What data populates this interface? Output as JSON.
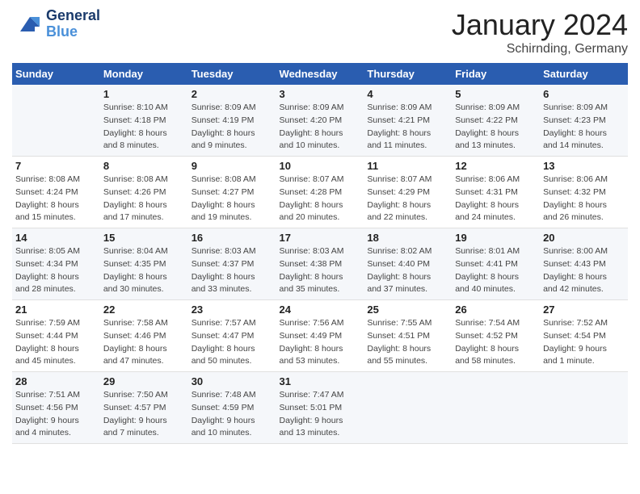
{
  "header": {
    "logo": {
      "general": "General",
      "blue": "Blue"
    },
    "title": "January 2024",
    "location": "Schirnding, Germany"
  },
  "days_of_week": [
    "Sunday",
    "Monday",
    "Tuesday",
    "Wednesday",
    "Thursday",
    "Friday",
    "Saturday"
  ],
  "weeks": [
    [
      {
        "day": "",
        "info": ""
      },
      {
        "day": "1",
        "info": "Sunrise: 8:10 AM\nSunset: 4:18 PM\nDaylight: 8 hours\nand 8 minutes."
      },
      {
        "day": "2",
        "info": "Sunrise: 8:09 AM\nSunset: 4:19 PM\nDaylight: 8 hours\nand 9 minutes."
      },
      {
        "day": "3",
        "info": "Sunrise: 8:09 AM\nSunset: 4:20 PM\nDaylight: 8 hours\nand 10 minutes."
      },
      {
        "day": "4",
        "info": "Sunrise: 8:09 AM\nSunset: 4:21 PM\nDaylight: 8 hours\nand 11 minutes."
      },
      {
        "day": "5",
        "info": "Sunrise: 8:09 AM\nSunset: 4:22 PM\nDaylight: 8 hours\nand 13 minutes."
      },
      {
        "day": "6",
        "info": "Sunrise: 8:09 AM\nSunset: 4:23 PM\nDaylight: 8 hours\nand 14 minutes."
      }
    ],
    [
      {
        "day": "7",
        "info": "Sunrise: 8:08 AM\nSunset: 4:24 PM\nDaylight: 8 hours\nand 15 minutes."
      },
      {
        "day": "8",
        "info": "Sunrise: 8:08 AM\nSunset: 4:26 PM\nDaylight: 8 hours\nand 17 minutes."
      },
      {
        "day": "9",
        "info": "Sunrise: 8:08 AM\nSunset: 4:27 PM\nDaylight: 8 hours\nand 19 minutes."
      },
      {
        "day": "10",
        "info": "Sunrise: 8:07 AM\nSunset: 4:28 PM\nDaylight: 8 hours\nand 20 minutes."
      },
      {
        "day": "11",
        "info": "Sunrise: 8:07 AM\nSunset: 4:29 PM\nDaylight: 8 hours\nand 22 minutes."
      },
      {
        "day": "12",
        "info": "Sunrise: 8:06 AM\nSunset: 4:31 PM\nDaylight: 8 hours\nand 24 minutes."
      },
      {
        "day": "13",
        "info": "Sunrise: 8:06 AM\nSunset: 4:32 PM\nDaylight: 8 hours\nand 26 minutes."
      }
    ],
    [
      {
        "day": "14",
        "info": "Sunrise: 8:05 AM\nSunset: 4:34 PM\nDaylight: 8 hours\nand 28 minutes."
      },
      {
        "day": "15",
        "info": "Sunrise: 8:04 AM\nSunset: 4:35 PM\nDaylight: 8 hours\nand 30 minutes."
      },
      {
        "day": "16",
        "info": "Sunrise: 8:03 AM\nSunset: 4:37 PM\nDaylight: 8 hours\nand 33 minutes."
      },
      {
        "day": "17",
        "info": "Sunrise: 8:03 AM\nSunset: 4:38 PM\nDaylight: 8 hours\nand 35 minutes."
      },
      {
        "day": "18",
        "info": "Sunrise: 8:02 AM\nSunset: 4:40 PM\nDaylight: 8 hours\nand 37 minutes."
      },
      {
        "day": "19",
        "info": "Sunrise: 8:01 AM\nSunset: 4:41 PM\nDaylight: 8 hours\nand 40 minutes."
      },
      {
        "day": "20",
        "info": "Sunrise: 8:00 AM\nSunset: 4:43 PM\nDaylight: 8 hours\nand 42 minutes."
      }
    ],
    [
      {
        "day": "21",
        "info": "Sunrise: 7:59 AM\nSunset: 4:44 PM\nDaylight: 8 hours\nand 45 minutes."
      },
      {
        "day": "22",
        "info": "Sunrise: 7:58 AM\nSunset: 4:46 PM\nDaylight: 8 hours\nand 47 minutes."
      },
      {
        "day": "23",
        "info": "Sunrise: 7:57 AM\nSunset: 4:47 PM\nDaylight: 8 hours\nand 50 minutes."
      },
      {
        "day": "24",
        "info": "Sunrise: 7:56 AM\nSunset: 4:49 PM\nDaylight: 8 hours\nand 53 minutes."
      },
      {
        "day": "25",
        "info": "Sunrise: 7:55 AM\nSunset: 4:51 PM\nDaylight: 8 hours\nand 55 minutes."
      },
      {
        "day": "26",
        "info": "Sunrise: 7:54 AM\nSunset: 4:52 PM\nDaylight: 8 hours\nand 58 minutes."
      },
      {
        "day": "27",
        "info": "Sunrise: 7:52 AM\nSunset: 4:54 PM\nDaylight: 9 hours\nand 1 minute."
      }
    ],
    [
      {
        "day": "28",
        "info": "Sunrise: 7:51 AM\nSunset: 4:56 PM\nDaylight: 9 hours\nand 4 minutes."
      },
      {
        "day": "29",
        "info": "Sunrise: 7:50 AM\nSunset: 4:57 PM\nDaylight: 9 hours\nand 7 minutes."
      },
      {
        "day": "30",
        "info": "Sunrise: 7:48 AM\nSunset: 4:59 PM\nDaylight: 9 hours\nand 10 minutes."
      },
      {
        "day": "31",
        "info": "Sunrise: 7:47 AM\nSunset: 5:01 PM\nDaylight: 9 hours\nand 13 minutes."
      },
      {
        "day": "",
        "info": ""
      },
      {
        "day": "",
        "info": ""
      },
      {
        "day": "",
        "info": ""
      }
    ]
  ]
}
